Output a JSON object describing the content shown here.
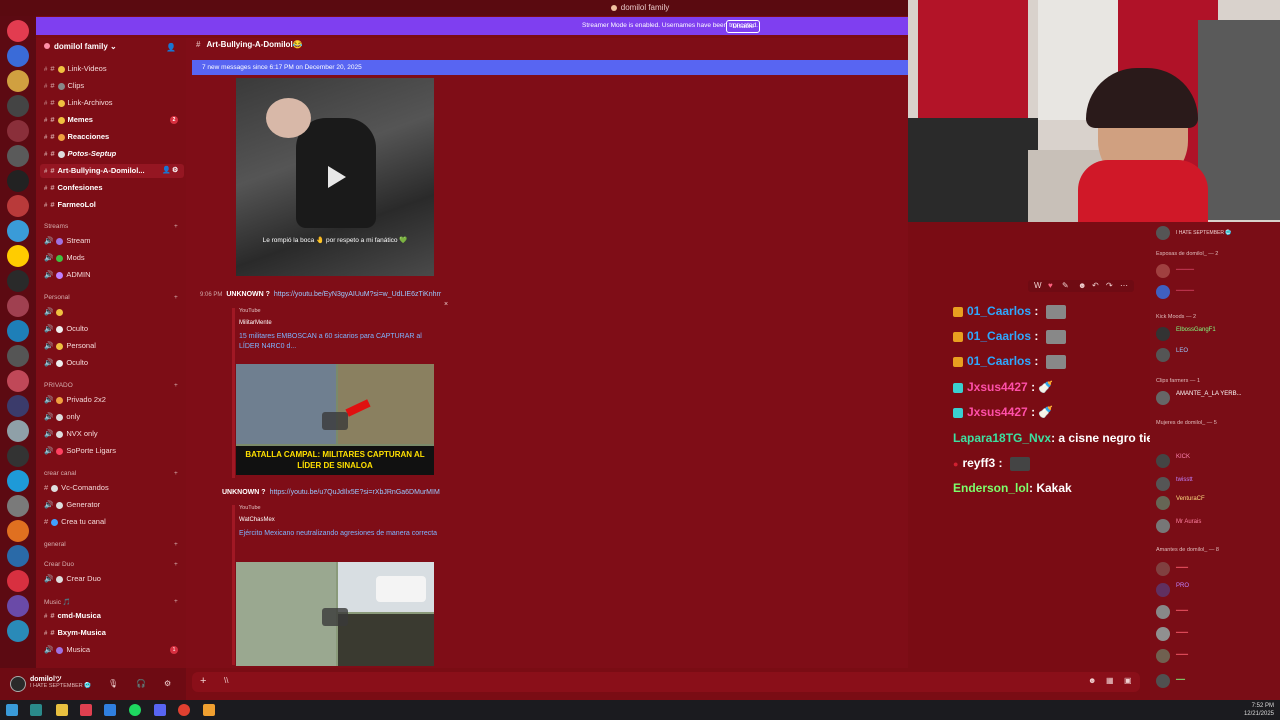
{
  "window": {
    "title": "domilol family"
  },
  "banner": {
    "text": "Streamer Mode is enabled. Usernames have been truncated.",
    "disable_label": "Disable"
  },
  "guild": {
    "name": "domilol family ⌄"
  },
  "channel": {
    "name": "Art-Bullying-A-Domilol😂"
  },
  "new_messages": "7 new messages since 6:17 PM on December 20, 2025",
  "sidebar": {
    "channels": [
      {
        "label": "Link-Videos"
      },
      {
        "label": "Clips"
      },
      {
        "label": "Link-Archivos"
      },
      {
        "label": "Memes",
        "unread": "2"
      },
      {
        "label": "Reacciones"
      },
      {
        "label": "Potos-Septup"
      },
      {
        "label": "Art-Bullying-A-Domilol..."
      },
      {
        "label": "Confesiones"
      },
      {
        "label": "FarmeoLol"
      }
    ],
    "categories": {
      "streams": "Streams",
      "personal": "Personal",
      "privado": "PRIVADO",
      "crear_canal": "crear canal",
      "general": "general",
      "crear_duo": "Crear Duo",
      "music": "Music 🎵"
    },
    "voice": {
      "stream": "Stream",
      "mods": "Mods",
      "admin": "ADMIN",
      "oculto1": "Oculto",
      "personal": "Personal",
      "oculto2": "Oculto",
      "privado2x2": "Privado 2x2",
      "only": "only",
      "nvx_only": "NVX only",
      "sopcrte": "SoPorte Ligars",
      "vc_comandos": "Vc-Comandos",
      "generator": "Generator",
      "crea_canal": "Crea tu canal",
      "crear_duo": "Crear Duo",
      "cmd_musica": "cmd-Musica",
      "bxym": "Bxym-Musica",
      "musica": "Musica",
      "musica_unread": "1"
    }
  },
  "user": {
    "name": "domilolツ",
    "status": "I HATE SEPTEMBER 🥶"
  },
  "messages": [
    {
      "time": "9:06 PM",
      "author": "UNKNOWN ?",
      "link": "https://youtu.be/EyN3gyAIUuM?si=w_UdLIE6zTiKnhrr",
      "provider": "YouTube",
      "channel": "MilitarMente",
      "title": "15 militares EMBOSCAN a 60 sicarios para CAPTURAR al LÍDER N4RC0 d...",
      "thumb_caption": "BATALLA CAMPAL: MILITARES CAPTURAN AL LÍDER DE SINALOA"
    },
    {
      "author": "UNKNOWN ?",
      "link": "https://youtu.be/u7QuJdIlx5E?si=rXbJRnGa6DMurMIM",
      "provider": "YouTube",
      "channel": "WatChasMex",
      "title": "Ejército Mexicano neutralizando agresiones de manera correcta"
    }
  ],
  "video_caption": "Le rompió la boca 🤚 por respeto a mi fanático 💚",
  "chat_overlay": [
    {
      "user": "01_Caarlos",
      "text": "",
      "color": "#2ea8ff"
    },
    {
      "user": "01_Caarlos",
      "text": "",
      "color": "#2ea8ff"
    },
    {
      "user": "01_Caarlos",
      "text": "",
      "color": "#2ea8ff"
    },
    {
      "user": "Jxsus4427",
      "text": "",
      "color": "#ff4fa8"
    },
    {
      "user": "Jxsus4427",
      "text": "",
      "color": "#ff4fa8"
    },
    {
      "user": "Lapara18TG_Nvx",
      "text": ": a cisne negro tiene que reacionar",
      "color": "#3de0a0"
    },
    {
      "user": "reyff3",
      "text": "",
      "color": "#ffffff"
    },
    {
      "user": "Enderson_lol",
      "text": ": Kakak",
      "color": "#7cff6b"
    }
  ],
  "members": {
    "top_status": "I HATE SEPTEMBER 🥶",
    "groups": [
      {
        "label": "Esposas de domilol_ — 2"
      },
      {
        "label": "Kick Moods — 2"
      },
      {
        "label": "Clips farmers — 1"
      },
      {
        "label": "Mujeres de domilol_ — 5"
      },
      {
        "label": "Amantes de domilol_ — 8"
      }
    ],
    "names": {
      "kick_user": "ElbossGangF1",
      "kick_user2": "LEO",
      "clip_user": "AMANTE_A_LA YERB...",
      "kick_tag": "KICK",
      "pro_tag": "PRO",
      "mujer1": "twisstt",
      "mujer2": "VenturaCF",
      "mujer3": "Mr Aurais"
    }
  },
  "taskbar": {
    "time": "7:52 PM",
    "date": "12/21/2025"
  },
  "colors": {
    "accent": "#5865f2",
    "streamer_banner": "#7f3ff0",
    "theme_red": "#7f0d17"
  }
}
